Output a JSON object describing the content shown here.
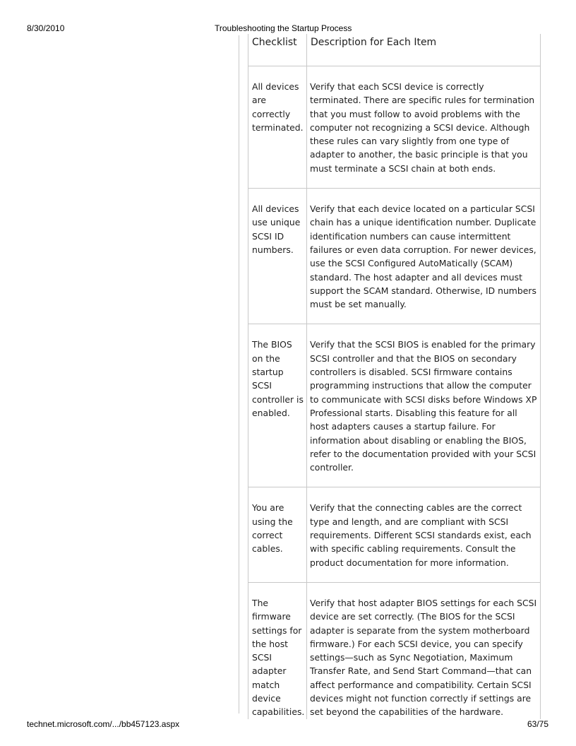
{
  "header": {
    "date": "8/30/2010",
    "title": "Troubleshooting the Startup Process"
  },
  "table": {
    "columns": [
      "Checklist",
      "Description for Each Item"
    ],
    "rows": [
      {
        "item": "All devices are correctly terminated.",
        "description": "Verify that each SCSI device is correctly terminated. There are specific rules for termination that you must follow to avoid problems with the computer not recognizing a SCSI device. Although these rules can vary slightly from one type of adapter to another, the basic principle is that you must terminate a SCSI chain at both ends."
      },
      {
        "item": "All devices use unique SCSI ID numbers.",
        "description": "Verify that each device located on a particular SCSI chain has a unique identification number. Duplicate identification numbers can cause intermittent failures or even data corruption. For newer devices, use the SCSI Configured AutoMatically (SCAM) standard. The host adapter and all devices must support the SCAM standard. Otherwise, ID numbers must be set manually."
      },
      {
        "item": "The BIOS on the startup SCSI controller is enabled.",
        "description": "Verify that the SCSI BIOS is enabled for the primary SCSI controller and that the BIOS on secondary controllers is disabled. SCSI firmware contains programming instructions that allow the computer to communicate with SCSI disks before Windows XP Professional starts. Disabling this feature for all host adapters causes a startup failure. For information about disabling or enabling the BIOS, refer to the documentation provided with your SCSI controller."
      },
      {
        "item": "You are using the correct cables.",
        "description": "Verify that the connecting cables are the correct type and length, and are compliant with SCSI requirements. Different SCSI standards exist, each with specific cabling requirements. Consult the product documentation for more information."
      },
      {
        "item": "The firmware settings for the host SCSI adapter match device capabilities.",
        "description": "Verify that host adapter BIOS settings for each SCSI device are set correctly. (The BIOS for the SCSI adapter is separate from the system motherboard firmware.) For each SCSI device, you can specify settings—such as Sync Negotiation, Maximum Transfer Rate, and Send Start Command—that can affect performance and compatibility. Certain SCSI devices might not function correctly if settings are set beyond the capabilities of the hardware."
      }
    ]
  },
  "footer": {
    "url": "technet.microsoft.com/.../bb457123.aspx",
    "page": "63/75"
  }
}
